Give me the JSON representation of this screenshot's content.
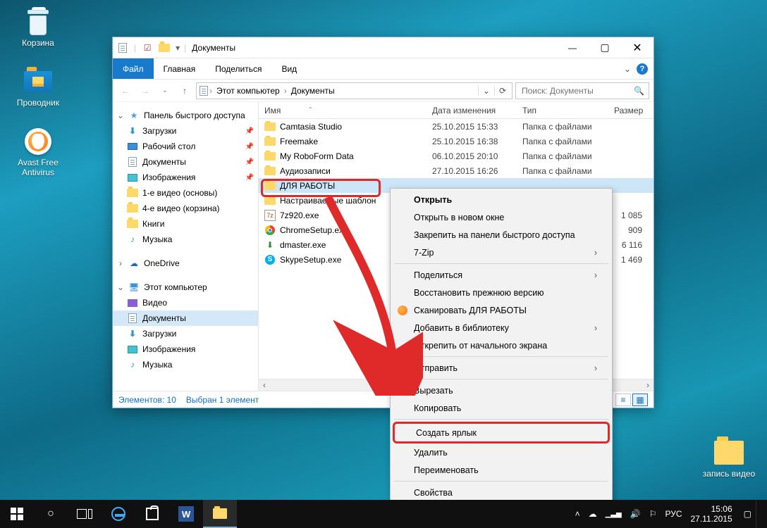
{
  "desktop": {
    "recycle": "Корзина",
    "explorer": "Проводник",
    "avast": "Avast Free\nAntivirus",
    "folder_br": "запись видео"
  },
  "window": {
    "title": "Документы",
    "tabs": {
      "file": "Файл",
      "home": "Главная",
      "share": "Поделиться",
      "view": "Вид"
    },
    "breadcrumb": {
      "root": "Этот компьютер",
      "leaf": "Документы"
    },
    "search_placeholder": "Поиск: Документы",
    "nav": {
      "quick": "Панель быстрого доступа",
      "downloads": "Загрузки",
      "desktop": "Рабочий стол",
      "documents": "Документы",
      "pictures": "Изображения",
      "f1": "1-е видео (основы)",
      "f4": "4-е видео (корзина)",
      "books": "Книги",
      "music": "Музыка",
      "onedrive": "OneDrive",
      "thispc": "Этот компьютер",
      "video": "Видео",
      "documents2": "Документы",
      "downloads2": "Загрузки",
      "pictures2": "Изображения",
      "music2": "Музыка"
    },
    "cols": {
      "name": "Имя",
      "date": "Дата изменения",
      "type": "Тип",
      "size": "Размер"
    },
    "rows": [
      {
        "name": "Camtasia Studio",
        "date": "25.10.2015 15:33",
        "type": "Папка с файлами",
        "size": "",
        "kind": "folder"
      },
      {
        "name": "Freemake",
        "date": "25.10.2015 16:38",
        "type": "Папка с файлами",
        "size": "",
        "kind": "folder"
      },
      {
        "name": "My RoboForm Data",
        "date": "06.10.2015 20:10",
        "type": "Папка с файлами",
        "size": "",
        "kind": "folder"
      },
      {
        "name": "Аудиозаписи",
        "date": "27.10.2015 16:26",
        "type": "Папка с файлами",
        "size": "",
        "kind": "folder"
      },
      {
        "name": "ДЛЯ РАБОТЫ",
        "date": "",
        "type": "",
        "size": "",
        "kind": "folder",
        "selected": true
      },
      {
        "name": "Настраиваемые шаблон",
        "date": "",
        "type": "",
        "size": "",
        "kind": "folder"
      },
      {
        "name": "7z920.exe",
        "date": "",
        "type": "",
        "size": "1 085",
        "kind": "7z"
      },
      {
        "name": "ChromeSetup.exe",
        "date": "",
        "type": "",
        "size": "909",
        "kind": "chrome"
      },
      {
        "name": "dmaster.exe",
        "date": "",
        "type": "",
        "size": "6 116",
        "kind": "dm"
      },
      {
        "name": "SkypeSetup.exe",
        "date": "",
        "type": "",
        "size": "1 469",
        "kind": "skype"
      }
    ],
    "status": {
      "count": "Элементов: 10",
      "sel": "Выбран 1 элемент"
    }
  },
  "context": [
    {
      "t": "item",
      "label": "Открыть",
      "bold": true
    },
    {
      "t": "item",
      "label": "Открыть в новом окне"
    },
    {
      "t": "item",
      "label": "Закрепить на панели быстрого доступа"
    },
    {
      "t": "item",
      "label": "7-Zip",
      "sub": true
    },
    {
      "t": "sep"
    },
    {
      "t": "item",
      "label": "Поделиться",
      "sub": true
    },
    {
      "t": "item",
      "label": "Восстановить прежнюю версию"
    },
    {
      "t": "item",
      "label": "Сканировать ДЛЯ РАБОТЫ",
      "icon": "avast"
    },
    {
      "t": "item",
      "label": "Добавить в библиотеку",
      "sub": true
    },
    {
      "t": "item",
      "label": "Открепить от начального экрана"
    },
    {
      "t": "sep"
    },
    {
      "t": "item",
      "label": "Отправить",
      "sub": true
    },
    {
      "t": "sep"
    },
    {
      "t": "item",
      "label": "Вырезать"
    },
    {
      "t": "item",
      "label": "Копировать"
    },
    {
      "t": "sep"
    },
    {
      "t": "item",
      "label": "Создать ярлык",
      "hl": true
    },
    {
      "t": "item",
      "label": "Удалить"
    },
    {
      "t": "item",
      "label": "Переименовать"
    },
    {
      "t": "sep"
    },
    {
      "t": "item",
      "label": "Свойства"
    }
  ],
  "taskbar": {
    "lang": "РУС",
    "time": "15:06",
    "date": "27.11.2015"
  }
}
